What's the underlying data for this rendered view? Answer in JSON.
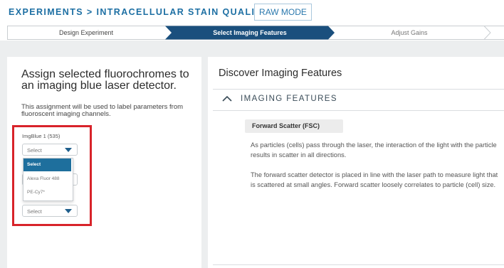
{
  "header": {
    "breadcrumb": "EXPERIMENTS > INTRACELLULAR STAIN QUALITY BTM",
    "raw_mode_label": "RAW MODE"
  },
  "stepper": {
    "steps": [
      {
        "label": "Design Experiment",
        "state": "done"
      },
      {
        "label": "Select Imaging Features",
        "state": "active"
      },
      {
        "label": "Adjust Gains",
        "state": "pending"
      }
    ],
    "colors": {
      "active": "#1a4f7d",
      "border": "#c9cdd1"
    }
  },
  "left": {
    "heading": "Assign selected fluorochromes to an imaging blue laser detector.",
    "subtext": "This assignment will be used to label parameters from fluoroscent imaging channels.",
    "field_label": "ImgBlue 1 (535)",
    "select_value": "Select",
    "second_select_value": "Select",
    "options": [
      "Select",
      "Alexa Fluor 488",
      "PE-Cy7*"
    ],
    "highlight_color": "#d8232a"
  },
  "right": {
    "heading": "Discover Imaging Features",
    "section_title": "IMAGING FEATURES",
    "feature_title": "Forward Scatter (FSC)",
    "paragraph_1": "As particles (cells) pass through the laser, the interaction of the light with the particle results in scatter in all directions.",
    "paragraph_2": "The forward scatter detector is placed in line with the laser path to measure light that is scattered at small angles. Forward scatter loosely correlates to particle (cell) size."
  }
}
